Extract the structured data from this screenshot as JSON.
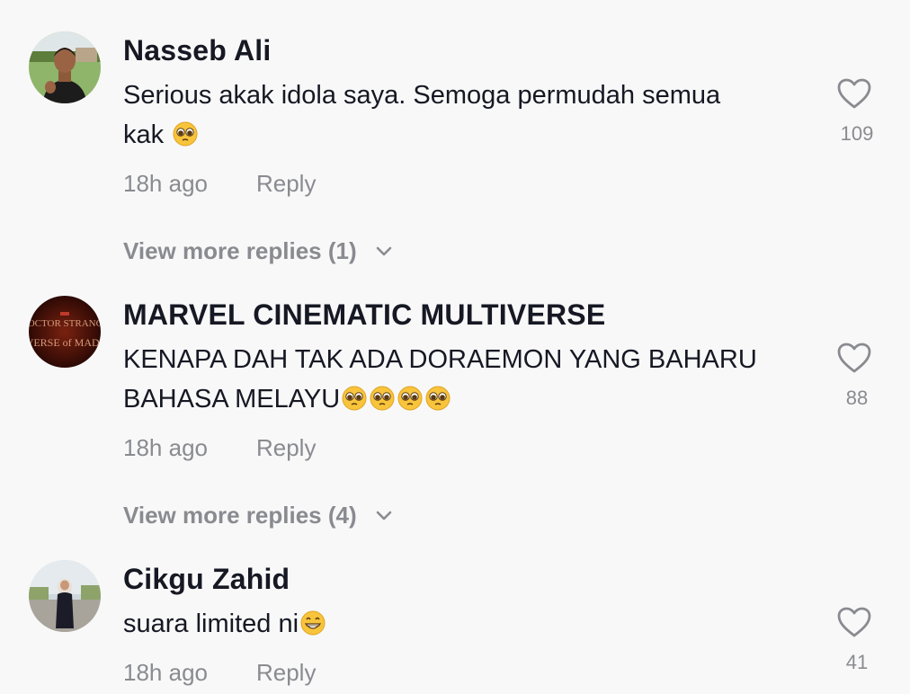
{
  "comments": [
    {
      "username": "Nasseb Ali",
      "text_line1": "Serious akak idola saya. Semoga permudah semua",
      "text_line2": "kak",
      "time": "18h ago",
      "reply": "Reply",
      "likes": "109",
      "view_more": "View more replies (1)",
      "avatar_icon": "profile-photo-man-thumbs-up"
    },
    {
      "username": "MARVEL CINEMATIC MULTIVERSE",
      "text_line1": "KENAPA DAH TAK ADA DORAEMON YANG BAHARU",
      "text_line2": "BAHASA MELAYU",
      "time": "18h ago",
      "reply": "Reply",
      "likes": "88",
      "view_more": "View more replies (4)",
      "avatar_icon": "doctor-strange-poster",
      "avatar_text_top": "DOCTOR STRANGE",
      "avatar_text_bottom": "IVERSE of MADN"
    },
    {
      "username": "Cikgu Zahid",
      "text_line1": "suara limited ni",
      "time": "18h ago",
      "reply": "Reply",
      "likes": "41",
      "avatar_icon": "profile-photo-woman-standing"
    }
  ],
  "colors": {
    "background": "#f8f8f8",
    "username": "#161823",
    "secondary": "#8a8b91"
  }
}
